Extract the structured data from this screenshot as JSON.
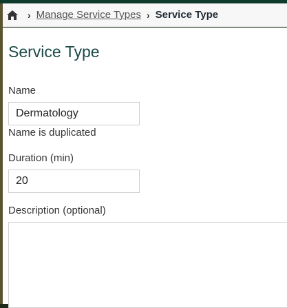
{
  "breadcrumb": {
    "home_icon": "home-icon",
    "items": [
      {
        "label": "Manage Service Types"
      },
      {
        "label": "Service Type"
      }
    ]
  },
  "page": {
    "title": "Service Type"
  },
  "form": {
    "name": {
      "label": "Name",
      "value": "Dermatology",
      "error": "Name is duplicated"
    },
    "duration": {
      "label": "Duration (min)",
      "value": "20"
    },
    "description": {
      "label": "Description (optional)",
      "value": ""
    }
  },
  "colors": {
    "title": "#1c4a48",
    "top_bar": "#0f3b2c"
  }
}
